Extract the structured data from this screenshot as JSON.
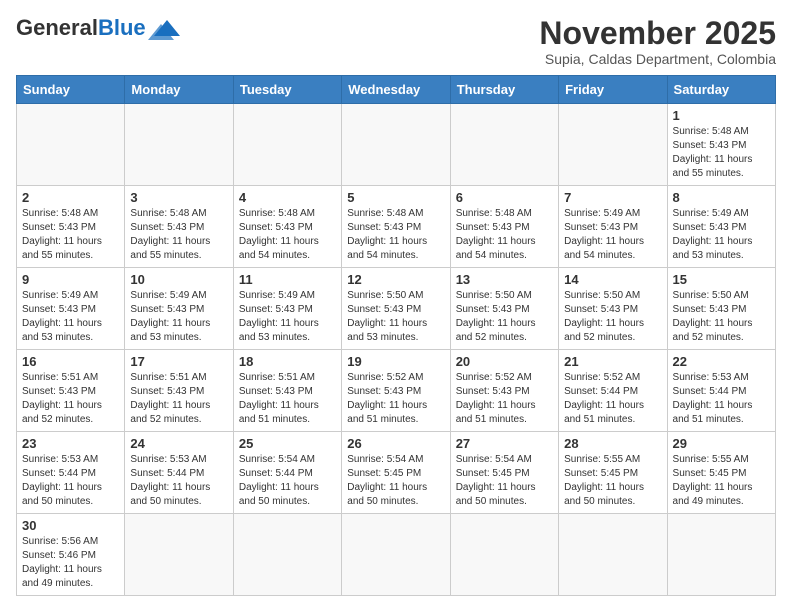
{
  "header": {
    "logo_general": "General",
    "logo_blue": "Blue",
    "month_title": "November 2025",
    "subtitle": "Supia, Caldas Department, Colombia"
  },
  "weekdays": [
    "Sunday",
    "Monday",
    "Tuesday",
    "Wednesday",
    "Thursday",
    "Friday",
    "Saturday"
  ],
  "weeks": [
    [
      {
        "day": "",
        "info": ""
      },
      {
        "day": "",
        "info": ""
      },
      {
        "day": "",
        "info": ""
      },
      {
        "day": "",
        "info": ""
      },
      {
        "day": "",
        "info": ""
      },
      {
        "day": "",
        "info": ""
      },
      {
        "day": "1",
        "info": "Sunrise: 5:48 AM\nSunset: 5:43 PM\nDaylight: 11 hours\nand 55 minutes."
      }
    ],
    [
      {
        "day": "2",
        "info": "Sunrise: 5:48 AM\nSunset: 5:43 PM\nDaylight: 11 hours\nand 55 minutes."
      },
      {
        "day": "3",
        "info": "Sunrise: 5:48 AM\nSunset: 5:43 PM\nDaylight: 11 hours\nand 55 minutes."
      },
      {
        "day": "4",
        "info": "Sunrise: 5:48 AM\nSunset: 5:43 PM\nDaylight: 11 hours\nand 54 minutes."
      },
      {
        "day": "5",
        "info": "Sunrise: 5:48 AM\nSunset: 5:43 PM\nDaylight: 11 hours\nand 54 minutes."
      },
      {
        "day": "6",
        "info": "Sunrise: 5:48 AM\nSunset: 5:43 PM\nDaylight: 11 hours\nand 54 minutes."
      },
      {
        "day": "7",
        "info": "Sunrise: 5:49 AM\nSunset: 5:43 PM\nDaylight: 11 hours\nand 54 minutes."
      },
      {
        "day": "8",
        "info": "Sunrise: 5:49 AM\nSunset: 5:43 PM\nDaylight: 11 hours\nand 53 minutes."
      }
    ],
    [
      {
        "day": "9",
        "info": "Sunrise: 5:49 AM\nSunset: 5:43 PM\nDaylight: 11 hours\nand 53 minutes."
      },
      {
        "day": "10",
        "info": "Sunrise: 5:49 AM\nSunset: 5:43 PM\nDaylight: 11 hours\nand 53 minutes."
      },
      {
        "day": "11",
        "info": "Sunrise: 5:49 AM\nSunset: 5:43 PM\nDaylight: 11 hours\nand 53 minutes."
      },
      {
        "day": "12",
        "info": "Sunrise: 5:50 AM\nSunset: 5:43 PM\nDaylight: 11 hours\nand 53 minutes."
      },
      {
        "day": "13",
        "info": "Sunrise: 5:50 AM\nSunset: 5:43 PM\nDaylight: 11 hours\nand 52 minutes."
      },
      {
        "day": "14",
        "info": "Sunrise: 5:50 AM\nSunset: 5:43 PM\nDaylight: 11 hours\nand 52 minutes."
      },
      {
        "day": "15",
        "info": "Sunrise: 5:50 AM\nSunset: 5:43 PM\nDaylight: 11 hours\nand 52 minutes."
      }
    ],
    [
      {
        "day": "16",
        "info": "Sunrise: 5:51 AM\nSunset: 5:43 PM\nDaylight: 11 hours\nand 52 minutes."
      },
      {
        "day": "17",
        "info": "Sunrise: 5:51 AM\nSunset: 5:43 PM\nDaylight: 11 hours\nand 52 minutes."
      },
      {
        "day": "18",
        "info": "Sunrise: 5:51 AM\nSunset: 5:43 PM\nDaylight: 11 hours\nand 51 minutes."
      },
      {
        "day": "19",
        "info": "Sunrise: 5:52 AM\nSunset: 5:43 PM\nDaylight: 11 hours\nand 51 minutes."
      },
      {
        "day": "20",
        "info": "Sunrise: 5:52 AM\nSunset: 5:43 PM\nDaylight: 11 hours\nand 51 minutes."
      },
      {
        "day": "21",
        "info": "Sunrise: 5:52 AM\nSunset: 5:44 PM\nDaylight: 11 hours\nand 51 minutes."
      },
      {
        "day": "22",
        "info": "Sunrise: 5:53 AM\nSunset: 5:44 PM\nDaylight: 11 hours\nand 51 minutes."
      }
    ],
    [
      {
        "day": "23",
        "info": "Sunrise: 5:53 AM\nSunset: 5:44 PM\nDaylight: 11 hours\nand 50 minutes."
      },
      {
        "day": "24",
        "info": "Sunrise: 5:53 AM\nSunset: 5:44 PM\nDaylight: 11 hours\nand 50 minutes."
      },
      {
        "day": "25",
        "info": "Sunrise: 5:54 AM\nSunset: 5:44 PM\nDaylight: 11 hours\nand 50 minutes."
      },
      {
        "day": "26",
        "info": "Sunrise: 5:54 AM\nSunset: 5:45 PM\nDaylight: 11 hours\nand 50 minutes."
      },
      {
        "day": "27",
        "info": "Sunrise: 5:54 AM\nSunset: 5:45 PM\nDaylight: 11 hours\nand 50 minutes."
      },
      {
        "day": "28",
        "info": "Sunrise: 5:55 AM\nSunset: 5:45 PM\nDaylight: 11 hours\nand 50 minutes."
      },
      {
        "day": "29",
        "info": "Sunrise: 5:55 AM\nSunset: 5:45 PM\nDaylight: 11 hours\nand 49 minutes."
      }
    ],
    [
      {
        "day": "30",
        "info": "Sunrise: 5:56 AM\nSunset: 5:46 PM\nDaylight: 11 hours\nand 49 minutes."
      },
      {
        "day": "",
        "info": ""
      },
      {
        "day": "",
        "info": ""
      },
      {
        "day": "",
        "info": ""
      },
      {
        "day": "",
        "info": ""
      },
      {
        "day": "",
        "info": ""
      },
      {
        "day": "",
        "info": ""
      }
    ]
  ]
}
